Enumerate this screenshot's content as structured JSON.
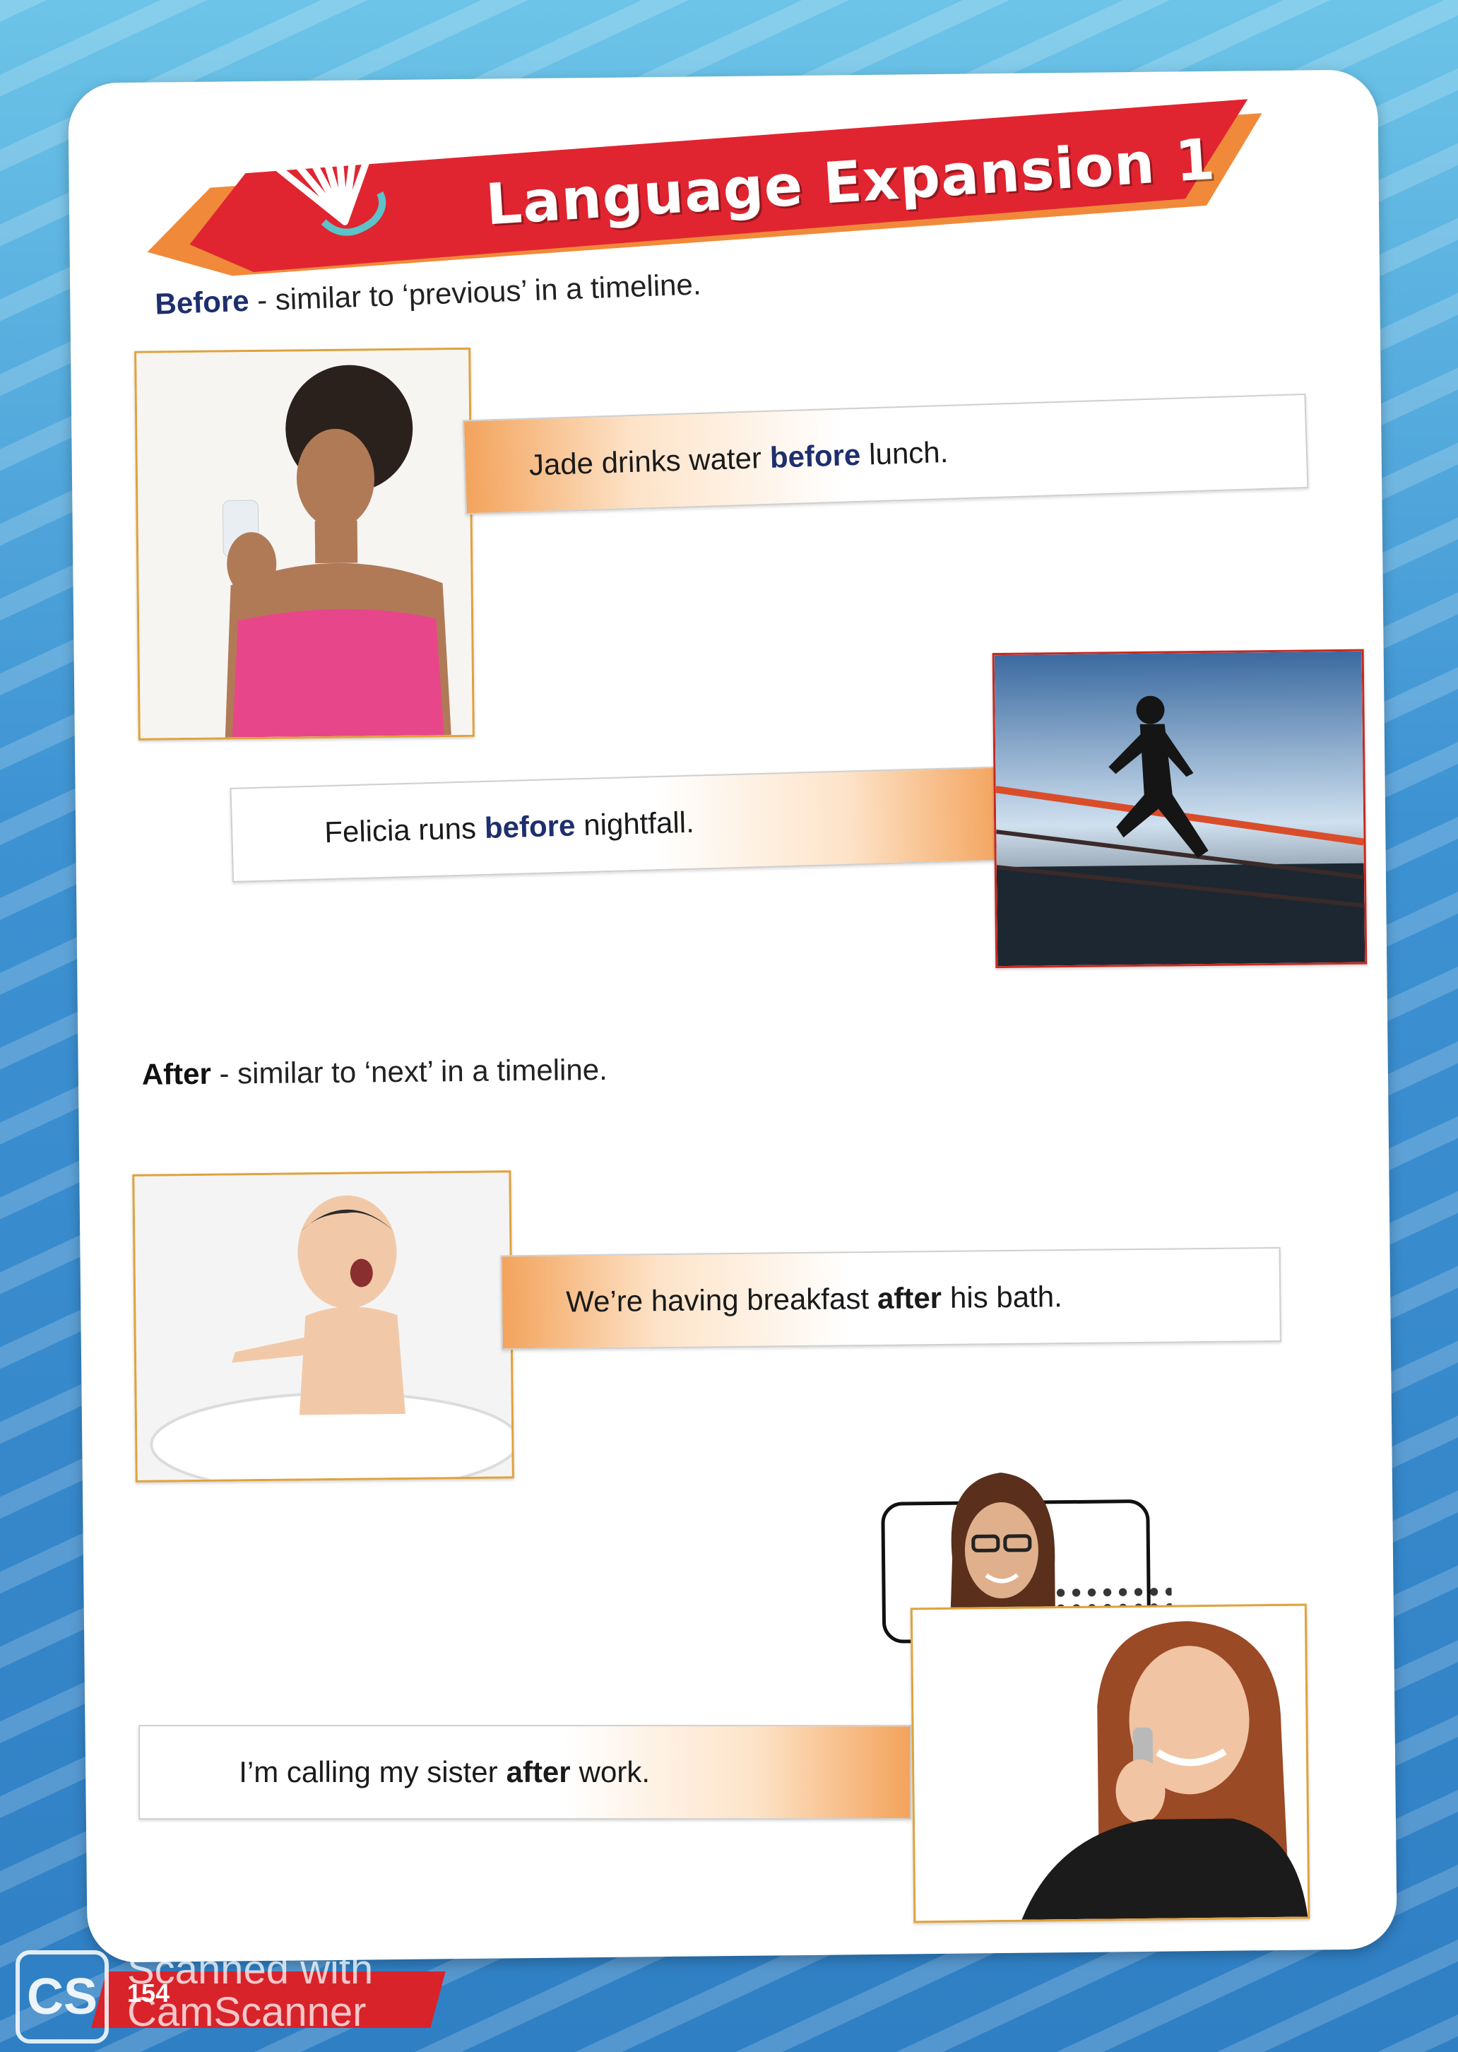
{
  "banner": {
    "title": "Language Expansion 1"
  },
  "sections": {
    "before": {
      "keyword": "Before",
      "definition": " - similar to ‘previous’ in a timeline."
    },
    "after": {
      "keyword": "After",
      "definition": " - similar to ‘next’ in a timeline."
    }
  },
  "examples": [
    {
      "pre": "Jade drinks water",
      "kw": "before",
      "post": "lunch."
    },
    {
      "pre": "Felicia runs",
      "kw": "before",
      "post": "nightfall."
    },
    {
      "pre": "We’re having breakfast",
      "kw": "after",
      "post": "his bath."
    },
    {
      "pre": "I’m calling my sister",
      "kw": "after",
      "post": "work."
    }
  ],
  "footer": {
    "page_number": "154",
    "watermark_line1": "Scanned with",
    "watermark_line2": "CamScanner",
    "logo_text": "CS"
  },
  "colors": {
    "banner_red": "#e02530",
    "accent_orange": "#f3a35c",
    "keyword_navy": "#1e2f6e"
  }
}
